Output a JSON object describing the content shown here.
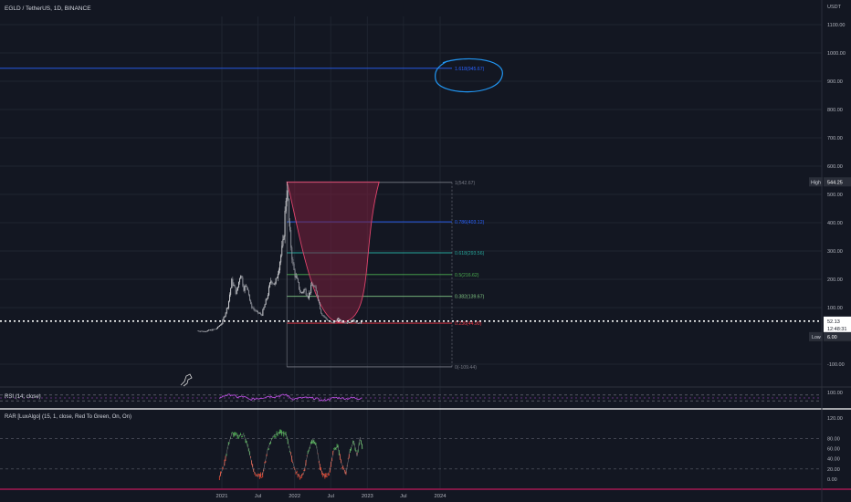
{
  "header": {
    "symbol_line": "EGLD / TetherUS, 1D, BINANCE",
    "currency": "USDT"
  },
  "colors": {
    "background": "#131722",
    "grid": "#1f2430",
    "axis_text": "#b2b5be",
    "candle_up": "#dcdde0",
    "candle_down": "#9598a1",
    "cup_fill": "#7a1f3d",
    "cup_stroke": "#e0446c",
    "price_line": "#ffffff",
    "rsi": "#b24bd6",
    "rar_green": "#4caf50",
    "rar_red": "#e0442e",
    "separator": "#c2185b",
    "annotation": "#2196f3"
  },
  "chart_data": [
    {
      "type": "line",
      "title": "EGLD / TetherUS, 1D, BINANCE",
      "y_unit": "USDT",
      "x_ticks": [
        "2021",
        "Jul",
        "2022",
        "Jul",
        "2023",
        "Jul",
        "2024"
      ],
      "y_ticks": [
        "-100.00",
        "100.00",
        "200.00",
        "300.00",
        "400.00",
        "500.00",
        "600.00",
        "700.00",
        "800.00",
        "900.00",
        "1000.00",
        "1100.00"
      ],
      "ylim": [
        -170,
        1160
      ],
      "series": [
        {
          "values": [
            [
              "2020-09-01",
              18
            ],
            [
              "2020-10-01",
              16
            ],
            [
              "2020-11-01",
              20
            ],
            [
              "2020-12-01",
              24
            ],
            [
              "2021-01-01",
              45
            ],
            [
              "2021-02-01",
              110
            ],
            [
              "2021-02-20",
              195
            ],
            [
              "2021-03-15",
              150
            ],
            [
              "2021-04-05",
              225
            ],
            [
              "2021-04-20",
              170
            ],
            [
              "2021-05-10",
              175
            ],
            [
              "2021-05-25",
              110
            ],
            [
              "2021-06-20",
              85
            ],
            [
              "2021-07-20",
              75
            ],
            [
              "2021-08-15",
              135
            ],
            [
              "2021-09-05",
              200
            ],
            [
              "2021-09-25",
              180
            ],
            [
              "2021-10-15",
              250
            ],
            [
              "2021-11-05",
              330
            ],
            [
              "2021-11-23",
              544
            ],
            [
              "2021-12-05",
              380
            ],
            [
              "2021-12-25",
              240
            ],
            [
              "2022-01-10",
              200
            ],
            [
              "2022-02-01",
              150
            ],
            [
              "2022-02-20",
              165
            ],
            [
              "2022-03-10",
              140
            ],
            [
              "2022-04-01",
              185
            ],
            [
              "2022-04-25",
              145
            ],
            [
              "2022-05-15",
              80
            ],
            [
              "2022-06-15",
              55
            ],
            [
              "2022-07-10",
              45
            ],
            [
              "2022-08-05",
              60
            ],
            [
              "2022-09-01",
              48
            ],
            [
              "2022-10-01",
              48
            ],
            [
              "2022-10-25",
              56
            ],
            [
              "2022-11-15",
              42
            ],
            [
              "2022-12-08",
              52
            ]
          ]
        }
      ],
      "fibonacci": [
        {
          "label": "1.618(945.67)",
          "value": 945.67,
          "color": "#2962ff"
        },
        {
          "label": "1(542.67)",
          "value": 542.67,
          "color": "#787b86"
        },
        {
          "label": "0.786(403.12)",
          "value": 403.12,
          "color": "#2962ff"
        },
        {
          "label": "0.618(293.56)",
          "value": 293.56,
          "color": "#26a69a"
        },
        {
          "label": "0.5(216.62)",
          "value": 216.62,
          "color": "#4caf50"
        },
        {
          "label": "0.382(139.67)",
          "value": 139.67,
          "color": "#81c784"
        },
        {
          "label": "0.236(44.90)",
          "value": 44.9,
          "color": "#f23645"
        },
        {
          "label": "0(-109.44)",
          "value": -109.44,
          "color": "#787b86"
        }
      ],
      "markers": [
        {
          "label": "High",
          "value": "544.25"
        },
        {
          "label": "Low",
          "value": "6.00"
        }
      ],
      "current_price": {
        "value": "52.13",
        "countdown": "12:48:31"
      },
      "cup": {
        "start_date": "2021-11-23",
        "end_date": "2023-03-01",
        "top": 544,
        "bottom": 48
      }
    },
    {
      "type": "line",
      "title": "RSI (14, close)",
      "y_ticks": [
        "100.00"
      ],
      "ylim": [
        0,
        100
      ],
      "bands": [
        30,
        70
      ],
      "series": [
        {
          "values": [
            [
              "2020-12-20",
              50
            ],
            [
              "2021-01-20",
              68
            ],
            [
              "2021-02-20",
              72
            ],
            [
              "2021-03-20",
              55
            ],
            [
              "2021-04-20",
              60
            ],
            [
              "2021-05-20",
              38
            ],
            [
              "2021-06-20",
              45
            ],
            [
              "2021-07-20",
              50
            ],
            [
              "2021-08-20",
              62
            ],
            [
              "2021-09-20",
              58
            ],
            [
              "2021-10-20",
              66
            ],
            [
              "2021-11-20",
              72
            ],
            [
              "2021-12-20",
              42
            ],
            [
              "2022-01-20",
              48
            ],
            [
              "2022-02-20",
              52
            ],
            [
              "2022-03-20",
              50
            ],
            [
              "2022-04-20",
              46
            ],
            [
              "2022-05-20",
              32
            ],
            [
              "2022-06-20",
              40
            ],
            [
              "2022-07-20",
              52
            ],
            [
              "2022-08-20",
              50
            ],
            [
              "2022-09-20",
              45
            ],
            [
              "2022-10-20",
              52
            ],
            [
              "2022-11-20",
              44
            ],
            [
              "2022-12-08",
              55
            ]
          ]
        }
      ]
    },
    {
      "type": "area",
      "title": "RAR [LuxAlgo] (15, 1, close, Red To Green, On, On)",
      "y_ticks": [
        "0.00",
        "20.00",
        "40.00",
        "60.00",
        "80.00",
        "120.00"
      ],
      "ylim": [
        -10,
        140
      ],
      "bands": [
        20,
        80
      ],
      "series": [
        {
          "values": [
            [
              "2020-12-20",
              5
            ],
            [
              "2021-01-10",
              25
            ],
            [
              "2021-02-01",
              65
            ],
            [
              "2021-02-20",
              90
            ],
            [
              "2021-03-20",
              85
            ],
            [
              "2021-04-20",
              88
            ],
            [
              "2021-05-15",
              60
            ],
            [
              "2021-06-10",
              15
            ],
            [
              "2021-07-01",
              5
            ],
            [
              "2021-07-25",
              10
            ],
            [
              "2021-08-20",
              60
            ],
            [
              "2021-09-15",
              85
            ],
            [
              "2021-10-20",
              92
            ],
            [
              "2021-11-20",
              88
            ],
            [
              "2021-12-15",
              45
            ],
            [
              "2022-01-05",
              15
            ],
            [
              "2022-01-25",
              5
            ],
            [
              "2022-02-15",
              10
            ],
            [
              "2022-03-10",
              55
            ],
            [
              "2022-04-01",
              78
            ],
            [
              "2022-04-20",
              65
            ],
            [
              "2022-05-10",
              20
            ],
            [
              "2022-06-01",
              5
            ],
            [
              "2022-06-25",
              15
            ],
            [
              "2022-07-15",
              55
            ],
            [
              "2022-08-05",
              65
            ],
            [
              "2022-08-25",
              30
            ],
            [
              "2022-09-15",
              10
            ],
            [
              "2022-10-05",
              55
            ],
            [
              "2022-10-25",
              75
            ],
            [
              "2022-11-10",
              45
            ],
            [
              "2022-11-25",
              82
            ],
            [
              "2022-12-08",
              60
            ]
          ]
        }
      ]
    }
  ]
}
